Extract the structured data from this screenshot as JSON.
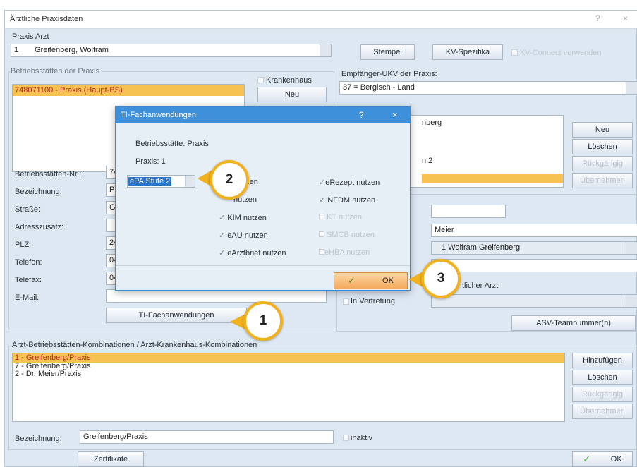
{
  "window": {
    "title": "Ärztliche Praxisdaten",
    "help_label": "?",
    "close_label": "×"
  },
  "praxis_arzt": {
    "label": "Praxis Arzt",
    "number": "1",
    "name": "Greifenberg, Wolfram"
  },
  "top_buttons": {
    "stempel": "Stempel",
    "kv": "KV-Spezifika",
    "kv_connect": "KV-Connect verwenden"
  },
  "bs": {
    "section_label": "Betriebsstätten der Praxis",
    "krankenhaus_label": "Krankenhaus",
    "neu_label": "Neu",
    "items": [
      "748071100 - Praxis (Haupt-BS)"
    ]
  },
  "empfaenger": {
    "label": "Empfänger-UKV der Praxis:",
    "value": "37 = Bergisch - Land"
  },
  "right_list": {
    "items": [
      "nberg",
      "n 2"
    ]
  },
  "right_buttons": {
    "neu": "Neu",
    "loeschen": "Löschen",
    "rueckgaengig": "Rückgängig",
    "uebernehmen": "Übernehmen"
  },
  "form": {
    "nr_label": "Betriebsstätten-Nr.:",
    "nr_value": "74",
    "bez_label": "Bezeichnung:",
    "bez_value": "Pr",
    "strasse_label": "Straße:",
    "strasse_value": "Ga",
    "adress_label": "Adresszusatz:",
    "adress_value": "",
    "plz_label": "PLZ:",
    "plz_value": "24",
    "tel_label": "Telefon:",
    "tel_value": "04",
    "fax_label": "Telefax:",
    "fax_value": "04",
    "email_label": "E-Mail:",
    "email_value": "",
    "ti_button": "TI-Fachanwendungen"
  },
  "right_form": {
    "meier": "Meier",
    "arzt_select": "1 Wolfram Greifenberg",
    "arzt_label": "tlicher Arzt",
    "vertretung_label": "In Vertretung",
    "asv_button": "ASV-Teamnummer(n)"
  },
  "kombi": {
    "label": "Arzt-Betriebsstätten-Kombinationen / Arzt-Krankenhaus-Kombinationen",
    "items": [
      "1 - Greifenberg/Praxis",
      "7 - Greifenberg/Praxis",
      "2 - Dr. Meier/Praxis"
    ],
    "buttons": {
      "add": "Hinzufügen",
      "delete": "Löschen",
      "undo": "Rückgängig",
      "apply": "Übernehmen"
    },
    "bez_label": "Bezeichnung:",
    "bez_value": "Greifenberg/Praxis",
    "inaktiv_label": "inaktiv"
  },
  "bottom": {
    "zertifikate": "Zertifikate",
    "ok": "OK"
  },
  "dialog": {
    "title": "TI-Fachanwendungen",
    "help": "?",
    "close": "×",
    "bs_line": "Betriebsstätte: Praxis",
    "praxis_line": "Praxis: 1",
    "epa_value": "ePA Stufe 2",
    "col1": [
      "nzen",
      "nutzen",
      "KIM nutzen",
      "eAU nutzen",
      "eArztbrief nutzen"
    ],
    "col2": [
      "eRezept nutzen",
      "NFDM nutzen",
      "KT nutzen",
      "SMCB nutzen",
      "eHBA nutzen"
    ],
    "ok": "OK"
  },
  "badges": [
    "1",
    "2",
    "3"
  ],
  "colors": {
    "accent_yellow": "#f2b21f",
    "selection": "#f6c251",
    "dialog_title": "#3f90db"
  }
}
